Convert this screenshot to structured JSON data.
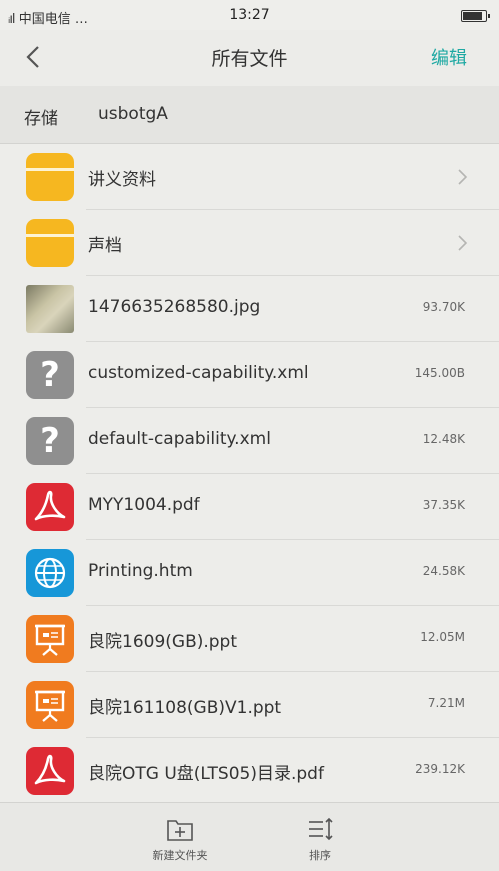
{
  "status_bar": {
    "carrier": "中国电信",
    "signal": "…",
    "time": "13:27",
    "battery_level": 0.9
  },
  "nav": {
    "title": "所有文件",
    "edit_label": "编辑"
  },
  "breadcrumb": {
    "root": "存储",
    "current": "usbotgA"
  },
  "files": [
    {
      "name": "讲义资料",
      "size": "",
      "icon": "folder-icon",
      "is_folder": true
    },
    {
      "name": "声档",
      "size": "",
      "icon": "folder-icon",
      "is_folder": true
    },
    {
      "name": "1476635268580.jpg",
      "size": "93.70K",
      "icon": "image-thumbnail",
      "is_folder": false
    },
    {
      "name": "customized-capability.xml",
      "size": "145.00B",
      "icon": "unknown-file-icon",
      "is_folder": false
    },
    {
      "name": "default-capability.xml",
      "size": "12.48K",
      "icon": "unknown-file-icon",
      "is_folder": false
    },
    {
      "name": "MYY1004.pdf",
      "size": "37.35K",
      "icon": "pdf-icon",
      "is_folder": false
    },
    {
      "name": "Printing.htm",
      "size": "24.58K",
      "icon": "globe-icon",
      "is_folder": false
    },
    {
      "name": "良院1609(GB).ppt",
      "size": "12.05M",
      "icon": "presentation-icon",
      "is_folder": false
    },
    {
      "name": "良院161108(GB)V1.ppt",
      "size": "7.21M",
      "icon": "presentation-icon",
      "is_folder": false
    },
    {
      "name": "良院OTG U盘(LTS05)目录.pdf",
      "size": "239.12K",
      "icon": "pdf-icon",
      "is_folder": false
    }
  ],
  "toolbar": {
    "new_folder_label": "新建文件夹",
    "sort_label": "排序"
  },
  "colors": {
    "accent": "#1fa9a3",
    "folder": "#f6b720",
    "pdf": "#de2a34",
    "htm": "#1797d8",
    "ppt": "#f07b1f",
    "unknown": "#8f8f8f"
  }
}
